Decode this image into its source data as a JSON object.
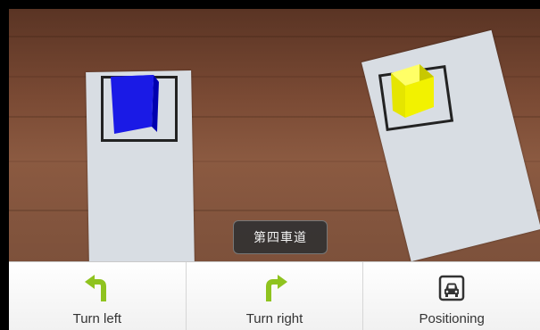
{
  "toast": {
    "text": "第四車道"
  },
  "actions": [
    {
      "label": "Turn left",
      "icon": "turn-left-arrow-icon",
      "color": "#8fc31f"
    },
    {
      "label": "Turn right",
      "icon": "turn-right-arrow-icon",
      "color": "#8fc31f"
    },
    {
      "label": "Positioning",
      "icon": "car-icon",
      "color": "#333333"
    }
  ],
  "scene": {
    "markers": [
      {
        "cube_color": "#1a1ae6"
      },
      {
        "cube_color": "#f2f200"
      }
    ]
  }
}
